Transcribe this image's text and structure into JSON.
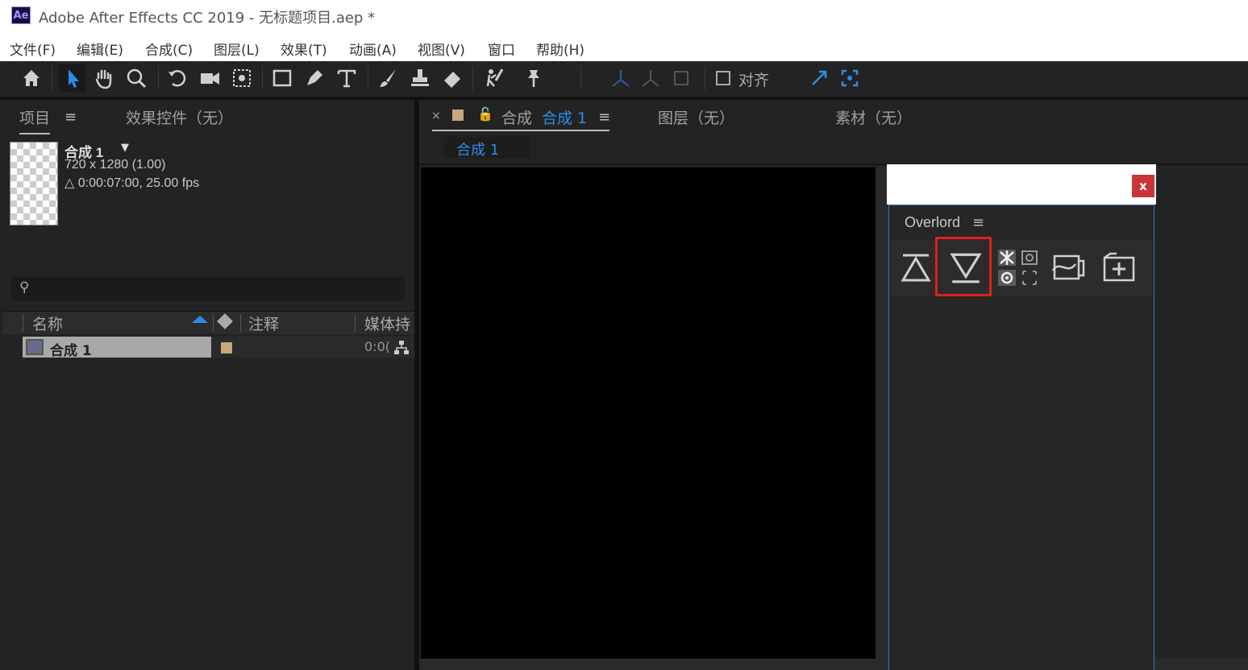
{
  "window": {
    "app_icon": "Ae",
    "title": "Adobe After Effects CC 2019 - 无标题项目.aep *"
  },
  "menu": [
    "文件(F)",
    "编辑(E)",
    "合成(C)",
    "图层(L)",
    "效果(T)",
    "动画(A)",
    "视图(V)",
    "窗口",
    "帮助(H)"
  ],
  "toolbar": {
    "align_label": "对齐",
    "tools": [
      "home-icon",
      "selection-arrow-icon",
      "hand-icon",
      "zoom-icon",
      "rotate-icon",
      "camera-icon",
      "pan-behind-icon",
      "rectangle-icon",
      "pen-icon",
      "type-icon",
      "brush-icon",
      "clone-stamp-icon",
      "eraser-icon",
      "roto-brush-icon",
      "puppet-pin-icon"
    ]
  },
  "project_panel": {
    "tab_project": "项目",
    "tab_effects": "效果控件（无）",
    "comp_name": "合成 1",
    "comp_size": "720 x 1280 (1.00)",
    "comp_duration": "△ 0:00:07:00, 25.00 fps",
    "columns": {
      "name": "名称",
      "comment": "注释",
      "media": "媒体持"
    },
    "items": [
      {
        "name": "合成 1",
        "media_duration": "0:0(",
        "label_color": "#c7a77b"
      }
    ]
  },
  "comp_panel": {
    "tab_prefix": "合成",
    "tab_comp_name": "合成 1",
    "tab_layer": "图层（无）",
    "tab_footage": "素材（无）",
    "sub_tab": "合成 1"
  },
  "overlord": {
    "close_label": "x",
    "panel_title": "Overlord",
    "buttons": [
      "push-to-ae-icon",
      "pull-from-ae-icon",
      "effects-grid-icon",
      "transform-icon",
      "new-comp-icon"
    ]
  },
  "colors": {
    "accent_blue": "#2d8ceb",
    "highlight_red": "#e0201c",
    "label_tan": "#c7a77b"
  }
}
